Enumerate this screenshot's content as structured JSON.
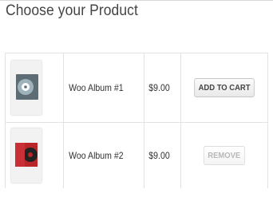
{
  "page": {
    "title": "Choose your Product"
  },
  "products": [
    {
      "name": "Woo Album #1",
      "price": "$9.00",
      "action_label": "ADD TO CART",
      "action_state": "enabled",
      "cover_color": "#5e6c73",
      "disc_color": "#9fb3bd"
    },
    {
      "name": "Woo Album #2",
      "price": "$9.00",
      "action_label": "REMOVE",
      "action_state": "disabled",
      "cover_color": "#b8262a",
      "disc_color": "#222222"
    }
  ]
}
